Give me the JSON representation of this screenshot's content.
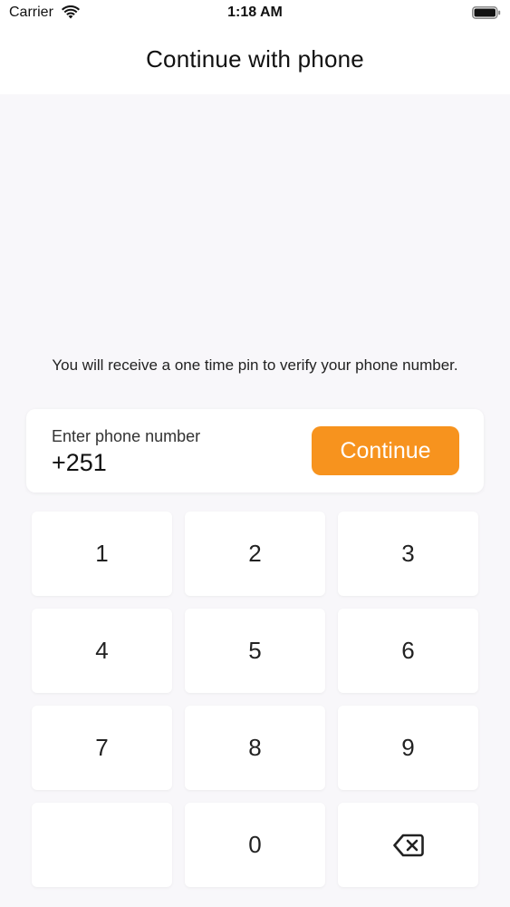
{
  "status_bar": {
    "carrier": "Carrier",
    "time": "1:18 AM",
    "wifi_icon": "wifi-icon",
    "battery_icon": "battery-icon"
  },
  "header": {
    "title": "Continue with phone"
  },
  "info": {
    "text": "You will receive a one time pin to verify your phone number."
  },
  "phone_form": {
    "label": "Enter phone number",
    "value": "+251",
    "continue_label": "Continue",
    "accent_color": "#f7931e"
  },
  "keypad": {
    "keys": [
      "1",
      "2",
      "3",
      "4",
      "5",
      "6",
      "7",
      "8",
      "9",
      "",
      "0"
    ],
    "backspace_icon": "backspace-icon"
  }
}
